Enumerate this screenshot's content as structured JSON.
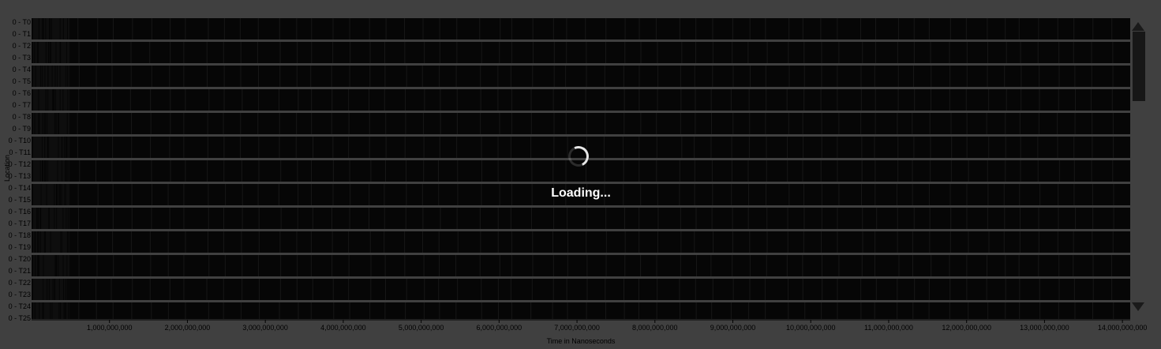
{
  "chart_data": {
    "type": "timeline",
    "lanes": [
      "0 - T0",
      "0 - T1",
      "0 - T2",
      "0 - T3",
      "0 - T4",
      "0 - T5",
      "0 - T6",
      "0 - T7",
      "0 - T8",
      "0 - T9",
      "0 - T10",
      "0 - T11",
      "0 - T12",
      "0 - T13",
      "0 - T14",
      "0 - T15",
      "0 - T16",
      "0 - T17",
      "0 - T18",
      "0 - T19",
      "0 - T20",
      "0 - T21",
      "0 - T22",
      "0 - T23",
      "0 - T24",
      "0 - T25"
    ],
    "x_ticks": [
      "1,000,000,000",
      "2,000,000,000",
      "3,000,000,000",
      "4,000,000,000",
      "5,000,000,000",
      "6,000,000,000",
      "7,000,000,000",
      "8,000,000,000",
      "9,000,000,000",
      "10,000,000,000",
      "11,000,000,000",
      "12,000,000,000",
      "13,000,000,000",
      "14,000,000,000"
    ],
    "xlabel": "Time in Nanoseconds",
    "ylabel": "Location",
    "xlim": [
      0,
      14100000000
    ],
    "grid": false,
    "colors": {
      "lane_fill": "#1a1a1a",
      "event_mark": "#5a5a5a",
      "dense_region": "#3a3a3a"
    }
  },
  "overlay": {
    "loading_text": "Loading...",
    "spinner_icon": "spinner-icon"
  },
  "scrollbar": {
    "up_icon": "triangle-up-icon",
    "down_icon": "triangle-down-icon",
    "position_fraction": 0.0,
    "visible_fraction": 0.25
  }
}
